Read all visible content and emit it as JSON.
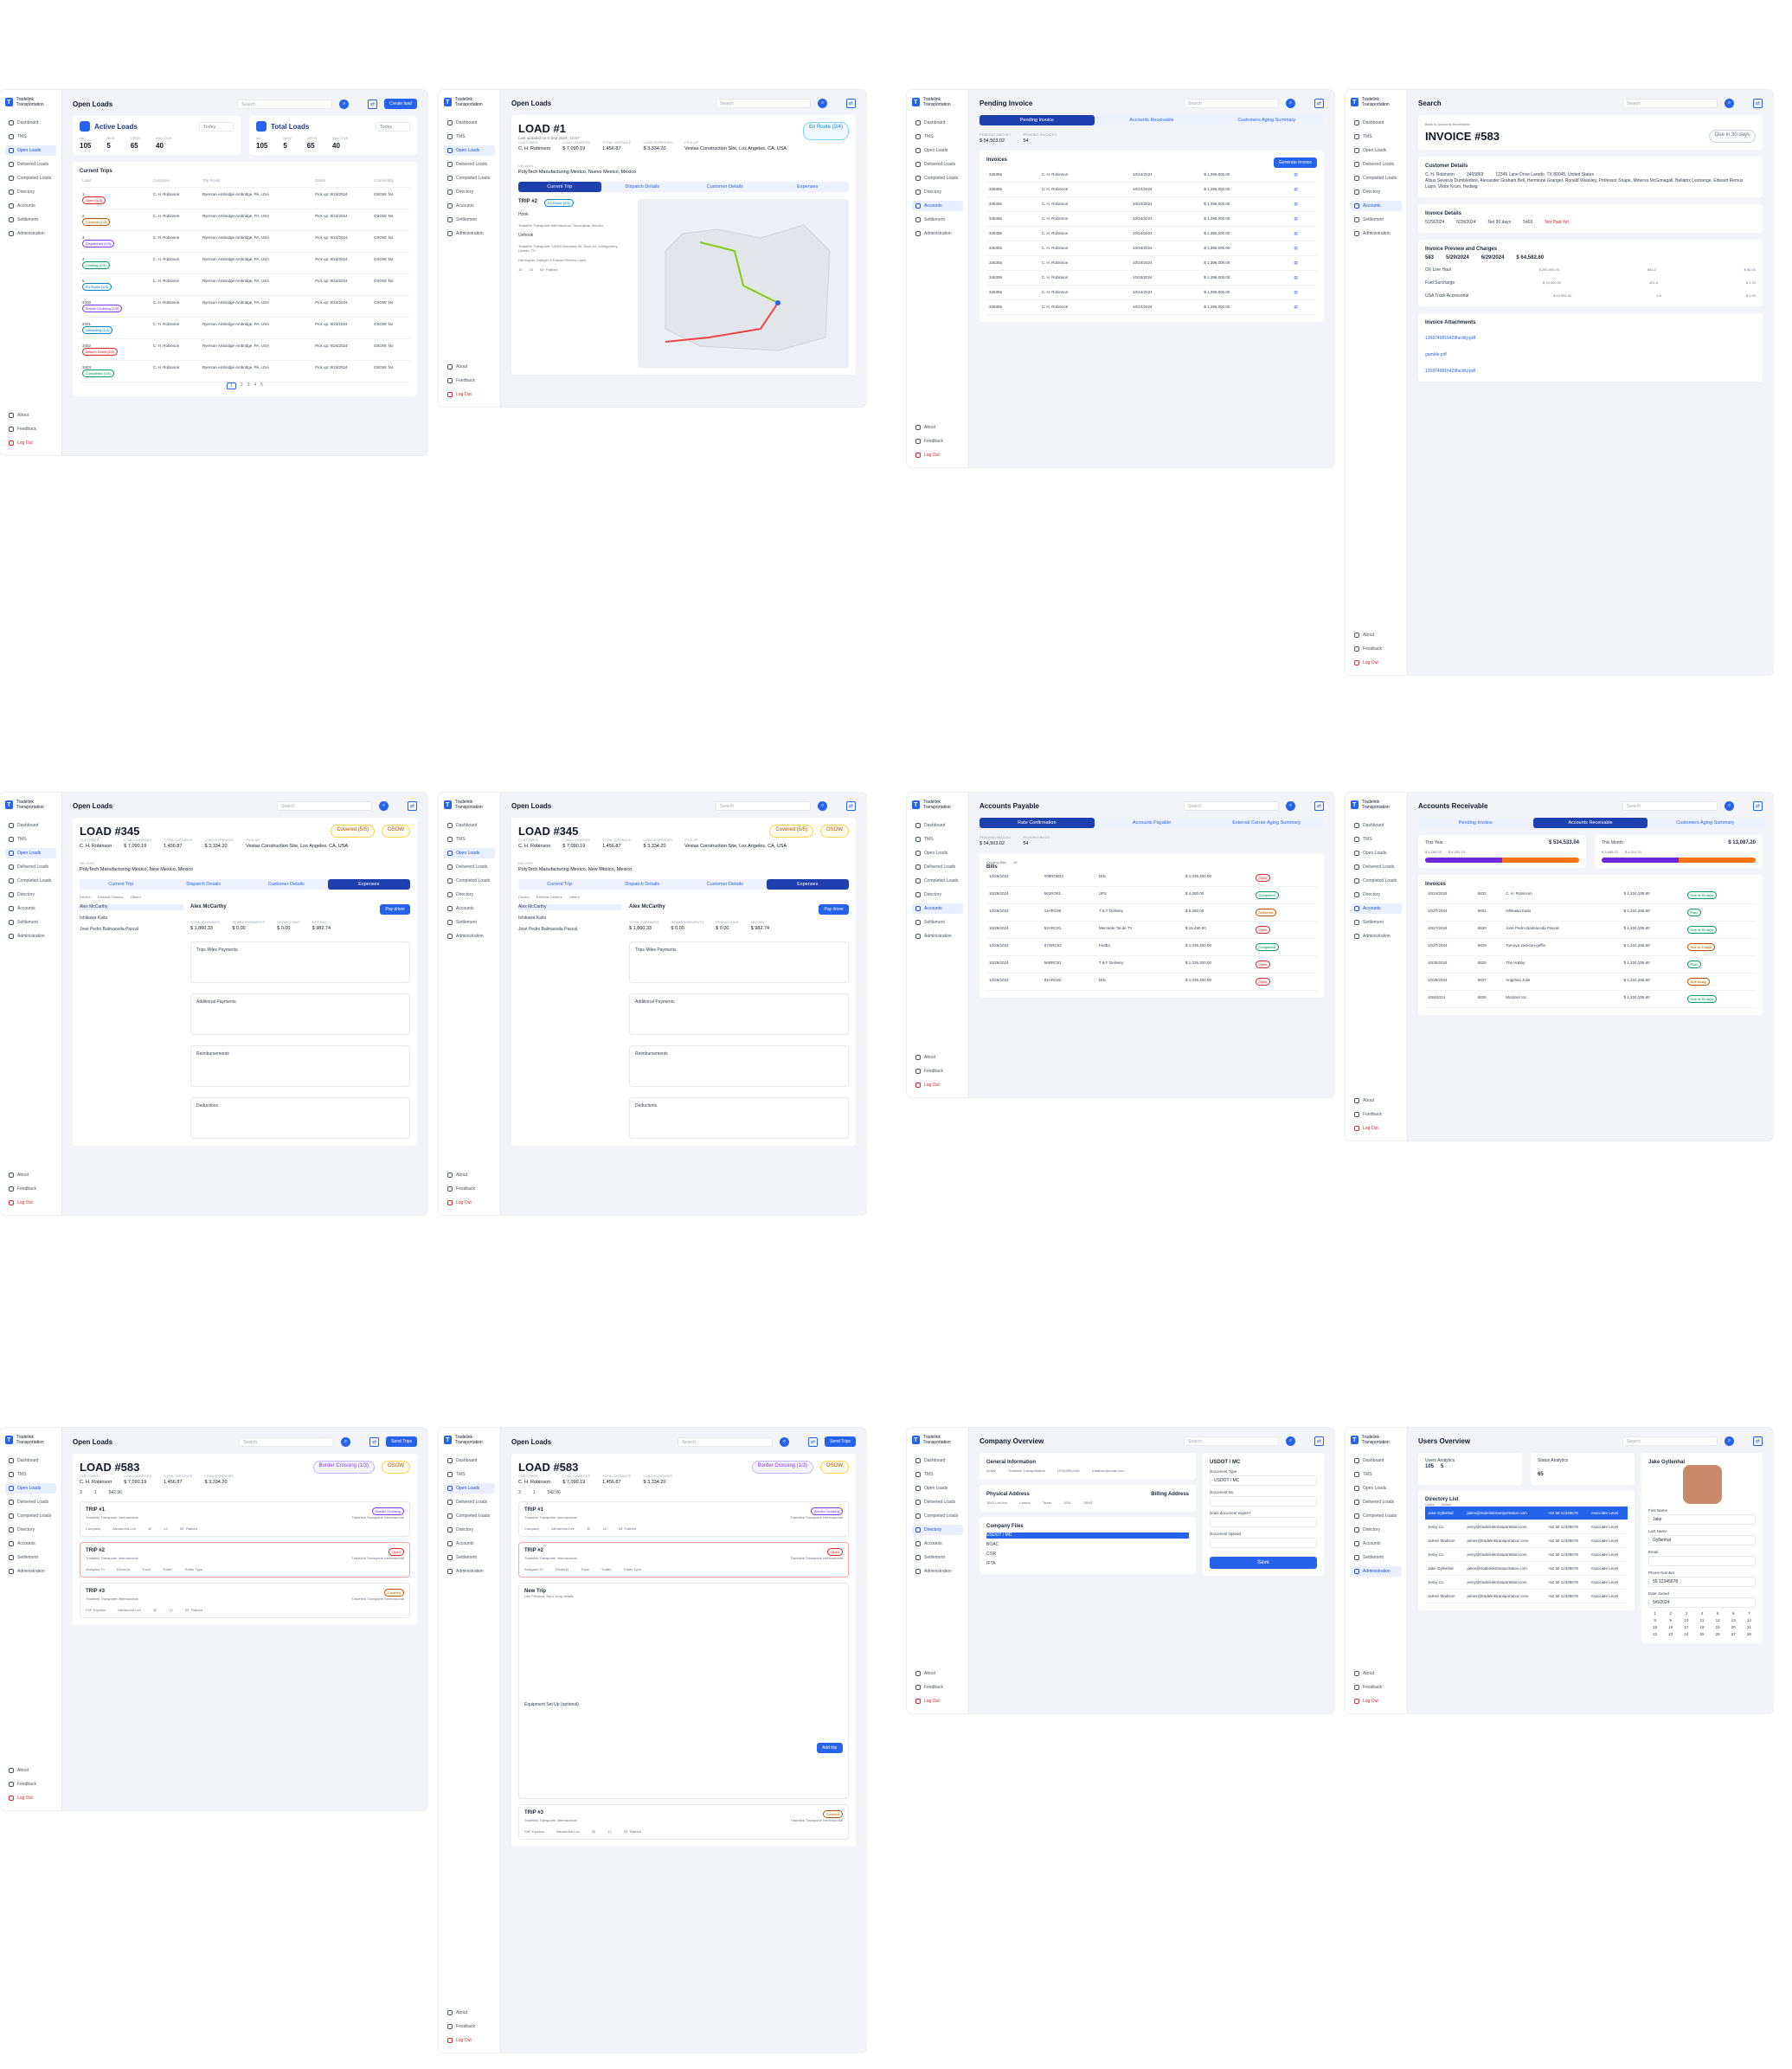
{
  "brand": {
    "name": "Tradelink Transportation"
  },
  "nav": [
    "Dashboard",
    "TMS",
    "Open Loads",
    "Delivered Loads",
    "Completed Loads",
    "Directory",
    "Accounts",
    "Settlement",
    "Administration",
    "About",
    "Feedback",
    "Log Out"
  ],
  "search_placeholder": "Search",
  "open_loads": {
    "title": "Open Loads",
    "create_btn": "Create load",
    "active": {
      "label": "Active Loads",
      "range": "Today",
      "vals": [
        {
          "k": "All",
          "v": "105"
        },
        {
          "k": "New",
          "v": "5"
        },
        {
          "k": "Open",
          "v": "65"
        },
        {
          "k": "Inactive",
          "v": "40"
        }
      ]
    },
    "total": {
      "label": "Total Loads",
      "range": "Today",
      "vals": [
        {
          "k": "All",
          "v": "105"
        },
        {
          "k": "New",
          "v": "5"
        },
        {
          "k": "Open",
          "v": "65"
        },
        {
          "k": "Inactive",
          "v": "40"
        }
      ]
    },
    "trips_title": "Current Trips",
    "columns": [
      "Load",
      "Customer",
      "Trip Route",
      "Dates",
      "Commodity"
    ],
    "rows": [
      {
        "load": "1",
        "status": "Open (1/4)",
        "color": "red",
        "customer": "C. H. Robinson",
        "route": "Ryerson Ambridge Ambridge, PA, USA",
        "dates": "Pick up: 8/24/2024",
        "commodity": "OSOW: No"
      },
      {
        "load": "2",
        "status": "Covered (1/3)",
        "color": "amber",
        "customer": "C. H. Robinson",
        "route": "Ryerson Ambridge Ambridge, PA, USA",
        "dates": "Pick up: 8/24/2024",
        "commodity": "OSOW: No"
      },
      {
        "load": "3",
        "status": "Dispatched (1/3)",
        "color": "purple",
        "customer": "C. H. Robinson",
        "route": "Ryerson Ambridge Ambridge, PA, USA",
        "dates": "Pick up: 8/24/2024",
        "commodity": "OSOW: No"
      },
      {
        "load": "4",
        "status": "Loading (1/3)",
        "color": "green",
        "customer": "C. H. Robinson",
        "route": "Ryerson Ambridge Ambridge, PA, USA",
        "dates": "Pick up: 8/24/2024",
        "commodity": "OSOW: No"
      },
      {
        "load": "5",
        "status": "En Route (1/3)",
        "color": "blue",
        "customer": "C. H. Robinson",
        "route": "Ryerson Ambridge Ambridge, PA, USA",
        "dates": "Pick up: 8/24/2024",
        "commodity": "OSOW: No"
      },
      {
        "load": "3400",
        "status": "Border Crossing (1/3)",
        "color": "purple",
        "customer": "C. H. Robinson",
        "route": "Ryerson Ambridge Ambridge, PA, USA",
        "dates": "Pick up: 8/24/2024",
        "commodity": "OSOW: No"
      },
      {
        "load": "3401",
        "status": "Unloading (1/3)",
        "color": "blue",
        "customer": "C. H. Robinson",
        "route": "Ryerson Ambridge Ambridge, PA, USA",
        "dates": "Pick up: 8/24/2024",
        "commodity": "OSOW: No"
      },
      {
        "load": "3402",
        "status": "Broken Down (1/3)",
        "color": "red",
        "customer": "C. H. Robinson",
        "route": "Ryerson Ambridge Ambridge, PA, USA",
        "dates": "Pick up: 8/24/2024",
        "commodity": "OSOW: No"
      },
      {
        "load": "3403",
        "status": "Completed (1/3)",
        "color": "green",
        "customer": "C. H. Robinson",
        "route": "Ryerson Ambridge Ambridge, PA, USA",
        "dates": "Pick up: 8/24/2024",
        "commodity": "OSOW: No"
      }
    ],
    "pages": [
      "1",
      "2",
      "3",
      "4",
      "5"
    ]
  },
  "load1": {
    "title": "LOAD #1",
    "updated": "Last updated on 8 Sep 2024, 12:47",
    "status": "En Route (2/4)",
    "meta": [
      {
        "k": "Customer",
        "v": "C. H. Robinson"
      },
      {
        "k": "Load Charges",
        "v": "$ 7,090.19"
      },
      {
        "k": "Total Distance",
        "v": "1,456.87"
      },
      {
        "k": "Load Expenses",
        "v": "$ 3,334.20"
      },
      {
        "k": "Pick Up",
        "v": "Vestas Construction Site, Los Angeles, CA, USA"
      },
      {
        "k": "Deliver",
        "v": "PolyTech Manufacturing Mexico, Nuevo Mexico, Mexico"
      }
    ],
    "tabs": [
      "Current Trip",
      "Dispatch Details",
      "Customer Details",
      "Expenses"
    ],
    "trip": "TRIP #2",
    "trip_status": "En Route (2/4)",
    "hook": "Hook",
    "unhook": "Unhook",
    "hook_addr": "Tradelink Transporte Internacional, Tamaulipas, Mexico",
    "unhook_addr": "Tradelink Transporte, 13000 Interstate 35, Suite #4, Montgomery, Laredo, TX",
    "driver": "Hermoplas Granger & Edward Remus Lupin",
    "truck": "12",
    "trailer": "23",
    "trailer_type": "53\" Flatbed"
  },
  "pending_invoice": {
    "title": "Pending Invoice",
    "tabs": [
      "Pending Invoice",
      "Accounts Receivable",
      "Customers Aging Summary"
    ],
    "amount_label": "Pending Amount",
    "amount": "$ 54,503.02",
    "count_label": "Pending Invoices",
    "count": "54",
    "section": "Invoices",
    "generate": "Generate Invoice",
    "rows": [
      {
        "id": "345355",
        "customer": "C. H. Robinson",
        "date": "10/24/2024",
        "amount": "$ 1,396,000.00"
      },
      {
        "id": "345355",
        "customer": "C. H. Robinson",
        "date": "10/24/2024",
        "amount": "$ 1,396,000.00"
      },
      {
        "id": "345355",
        "customer": "C. H. Robinson",
        "date": "10/24/2024",
        "amount": "$ 1,396,000.00"
      },
      {
        "id": "345355",
        "customer": "C. H. Robinson",
        "date": "10/24/2024",
        "amount": "$ 1,396,000.00"
      },
      {
        "id": "345355",
        "customer": "C. H. Robinson",
        "date": "10/24/2024",
        "amount": "$ 1,396,000.00"
      },
      {
        "id": "345355",
        "customer": "C. H. Robinson",
        "date": "10/24/2024",
        "amount": "$ 1,396,000.00"
      },
      {
        "id": "345355",
        "customer": "C. H. Robinson",
        "date": "10/24/2024",
        "amount": "$ 1,396,000.00"
      },
      {
        "id": "345355",
        "customer": "C. H. Robinson",
        "date": "10/24/2024",
        "amount": "$ 1,396,000.00"
      },
      {
        "id": "345355",
        "customer": "C. H. Robinson",
        "date": "10/24/2024",
        "amount": "$ 1,396,000.00"
      },
      {
        "id": "345355",
        "customer": "C. H. Robinson",
        "date": "10/24/2024",
        "amount": "$ 1,396,000.00"
      }
    ]
  },
  "invoice583": {
    "back": "Back to Accounts Receivable",
    "title": "INVOICE #583",
    "due": "Due in 30 days",
    "customer_details": "Customer Details",
    "customer": "C. H. Robinson",
    "mc": "3465869",
    "billing": "12345 Lane Drive Laredo, TX 80045, United States",
    "contacts": "Albus Severus Dumbledore, Alexander Graham Bell, Hermione Granger, Ronald Weasley, Professor Snape, Minerva McGonagall, Bellatrix Lestrange, Edward Remus Lupin, Viktor Krum, Hedwig",
    "invoice_details": "Invoice Details",
    "inv_date": "5/29/2024",
    "due_date": "6/28/2024",
    "terms": "Net 30 days",
    "load": "5403",
    "payment": "Not Paid Yet",
    "preview": "Invoice Preview and Charges",
    "invoice_no": "583",
    "invoice_date": "5/29/2024",
    "due_on": "6/29/2024",
    "total": "$ 64,582.60",
    "charges": [
      {
        "name": "OX Line Haul",
        "amt": "$ 250,000.00",
        "qty": "583.0",
        "rate": "$ 50.00"
      },
      {
        "name": "Fuel Surcharge",
        "amt": "$ 20,000.00",
        "qty": "421.4",
        "rate": "$ 2.49"
      },
      {
        "name": "USA Truck Accessorial",
        "amt": "$ 14,552.00",
        "qty": "4.5",
        "rate": "$ 1.93"
      }
    ],
    "attachments": "Invoice Attachments",
    "files": [
      "1358749816428facility.pdf",
      "gamble.pdf",
      "1358749816428facility.pdf"
    ]
  },
  "load345": {
    "title": "LOAD #345",
    "status": "Covered (5/5)",
    "osow": "OSOW",
    "meta": [
      {
        "k": "Customer",
        "v": "C. H. Robinson"
      },
      {
        "k": "Load Charges",
        "v": "$ 7,090.19"
      },
      {
        "k": "Total Distance",
        "v": "1,456.87"
      },
      {
        "k": "Load Expenses",
        "v": "$ 3,334.20"
      },
      {
        "k": "Pick Up",
        "v": "Vestas Construction Site, Los Angeles, CA, USA"
      },
      {
        "k": "Deliver",
        "v": "PolyTech Manufacturing Mexico, New Mexico, Mexico"
      }
    ],
    "tabs": [
      "Current Trip",
      "Dispatch Details",
      "Customer Details",
      "Expenses"
    ],
    "subtabs": [
      "Drivers",
      "External Carriers",
      "Others"
    ],
    "drivers": [
      "Alex McCarthy",
      "Ishikawa Kaito",
      "José Pedro Balmaceda Pascal"
    ],
    "driver_name": "Alex McCarthy",
    "pay_driver": "Pay driver",
    "sections": [
      "Trips Miles Payments",
      "Additional Payments",
      "Reimbursements",
      "Deductions"
    ],
    "totals": [
      {
        "k": "Total Earnings",
        "v": "$ 1,860.33"
      },
      {
        "k": "Reimbursements",
        "v": "$ 0.00"
      },
      {
        "k": "Deductions",
        "v": "$ 0.00"
      },
      {
        "k": "Net Pay",
        "v": "$ 982.74"
      }
    ]
  },
  "accounts_payable": {
    "title": "Accounts Payable",
    "tabs": [
      "Rate Confirmation",
      "Accounts Payable",
      "External Carrier Aging Summary"
    ],
    "pending_label": "Pending Amount",
    "pending": "$ 54,503.02",
    "bills_label": "Pending Bills",
    "bills_count": "54",
    "subtabs": [
      "Pending Bills",
      "All"
    ],
    "section": "Bills",
    "rows": [
      {
        "date": "10/29/2024",
        "conf": "#09ROB22",
        "carrier": "DHL",
        "amount": "$ 1,035,200.00",
        "status": "Open",
        "color": "red"
      },
      {
        "date": "10/29/2024",
        "conf": "562RO81",
        "carrier": "UPS",
        "amount": "$ 4,000.00",
        "status": "Completed",
        "color": "green"
      },
      {
        "date": "10/29/2024",
        "conf": "11HRC88",
        "carrier": "T & F Delivery",
        "amount": "$ 6,250.00",
        "status": "Delivered",
        "color": "amber"
      },
      {
        "date": "10/29/2024",
        "conf": "52ARC81",
        "carrier": "Mercante Tal de TV",
        "amount": "$ 15,490.00",
        "status": "Open",
        "color": "red"
      },
      {
        "date": "10/29/2024",
        "conf": "07ORC62",
        "carrier": "FedEx",
        "amount": "$ 1,035,200.00",
        "status": "Completed",
        "color": "green"
      },
      {
        "date": "10/29/2024",
        "conf": "56RRC81",
        "carrier": "T & F Delivery",
        "amount": "$ 1,035,200.00",
        "status": "Open",
        "color": "red"
      },
      {
        "date": "10/29/2024",
        "conf": "81ARC82",
        "carrier": "DHL",
        "amount": "$ 1,035,200.00",
        "status": "Open",
        "color": "red"
      }
    ]
  },
  "accounts_receivable": {
    "title": "Accounts Receivable",
    "tabs": [
      "Pending Invoice",
      "Accounts Receivable",
      "Customers Aging Summary"
    ],
    "year_label": "This Year",
    "year_total": "$ 534,533.04",
    "month_label": "This Month",
    "month_total": "$ 13,087.20",
    "overdue_label": "Overdue",
    "overdue": "$ 4,265.03",
    "current_label": "Current",
    "current": "$ 6,255.15",
    "m_overdue": "$ 5,685.03",
    "m_current": "$ 4,210.70",
    "section": "Invoices",
    "rows": [
      {
        "date": "10/24/2024",
        "id": "5832",
        "customer": "C. H. Robinson",
        "amount": "$ 1,234,285.90",
        "status": "Due in 30 days",
        "color": "green"
      },
      {
        "date": "10/27/2024",
        "id": "5831",
        "customer": "Ishikawa Kaito",
        "amount": "$ 1,234,285.90",
        "status": "Paid",
        "color": "green"
      },
      {
        "date": "10/27/2024",
        "id": "5830",
        "customer": "José Pedro Balmaceda Pascal",
        "amount": "$ 1,234,285.90",
        "status": "Due in 30 days",
        "color": "green"
      },
      {
        "date": "10/27/2024",
        "id": "5829",
        "customer": "Tomoya Jackson-griffin",
        "amount": "$ 1,234,285.90",
        "status": "Due in 5 days",
        "color": "amber"
      },
      {
        "date": "10/30/2024",
        "id": "5828",
        "customer": "The Hobby",
        "amount": "$ 1,234,285.90",
        "status": "Paid",
        "color": "green"
      },
      {
        "date": "10/30/2024",
        "id": "5827",
        "customer": "Angelina Jolie",
        "amount": "$ 1,234,285.90",
        "status": "Due today",
        "color": "amber"
      },
      {
        "date": "10/6/2024",
        "id": "5826",
        "customer": "Mordoor Inc.",
        "amount": "$ 1,234,285.90",
        "status": "Due in 30 days",
        "color": "green"
      }
    ]
  },
  "load583": {
    "title": "LOAD #583",
    "status": "Border Crossing (1/3)",
    "osow": "OSOW",
    "send_trips": "Send Trips",
    "meta": [
      {
        "k": "Customer",
        "v": "C. H. Robinson"
      },
      {
        "k": "Load Charges",
        "v": "$ 7,090.19"
      },
      {
        "k": "Total Distance",
        "v": "1,456.87"
      },
      {
        "k": "Load Expenses",
        "v": "$ 3,334.20"
      }
    ],
    "total_trips": "3",
    "open_trips": "1",
    "miles": "542.96",
    "trips": [
      {
        "name": "TRIP #1",
        "status": "Border Crossing",
        "color": "purple",
        "from": "Tradelink Transporte Internacional",
        "to": "Tradelink Transporte Internacional",
        "assigned": "Company",
        "driver": "Alexandria Lee",
        "truck": "32",
        "trailer": "12",
        "trailer_type": "53\" Flatbed"
      },
      {
        "name": "TRIP #2",
        "status": "Open",
        "color": "red",
        "from": "Tradelink Transporte Internacional",
        "to": "Tradelink Transporte Internacional",
        "assigned": "Assigned To",
        "driver": "Driver(s)",
        "truck": "Truck",
        "trailer": "Trailer",
        "trailer_type": "Trailer Type"
      },
      {
        "name": "TRIP #3",
        "status": "Covered",
        "color": "amber",
        "from": "Tradelink Transporte Internacional",
        "to": "Tradelink Transporte Internacional",
        "assigned": "F&F Express",
        "driver": "Alexandria Lee",
        "truck": "32",
        "trailer": "12",
        "trailer_type": "53\" Flatbed"
      }
    ],
    "new_trip": "New Trip",
    "use_prev": "Use Previous Trip's Drop details",
    "equipment": "Equipment Set Up (optional)",
    "add_trip": "Add trip"
  },
  "company": {
    "title": "Company Overview",
    "general": "General Information",
    "status": "Active",
    "company_name": "Tradelink Transportation",
    "contact": "(325)555-6481",
    "email": "tradelink@email.com",
    "physical": "Physical Address",
    "billing": "Billing Address",
    "address": "1500 Lott Ave",
    "city": "Laredo",
    "country": "USA",
    "state": "Texas",
    "zip": "78045",
    "files": "Company Files",
    "file_rows": [
      "USDOT / MC",
      "BOAC",
      "COR",
      "IFTA"
    ],
    "modal_title": "USDOT / MC",
    "doc_type_label": "Document Type",
    "doc_type": "USDOT / MC",
    "doc_no_label": "Document No",
    "approve_label": "Does document expire?",
    "upload_label": "Document Upload",
    "save": "Save"
  },
  "users": {
    "title": "Users Overview",
    "users_label": "Users Analytics",
    "total": "105",
    "new": "5",
    "status_label": "Status Analytics",
    "active": "65",
    "directory": "Directory List",
    "tabs": [
      "Users",
      "Invites"
    ],
    "rows": [
      {
        "name": "Jake Gyllenhal",
        "email": "jakes@tradelinktransportation.com",
        "phone": "+52 55 12345678",
        "role": "Associate Level"
      },
      {
        "name": "Jessy Co",
        "email": "jessy@tradelinktransportation.com",
        "phone": "+52 55 12345678",
        "role": "Associate Level"
      },
      {
        "name": "James Madison",
        "email": "james@tradelinktransportation.com",
        "phone": "+52 55 12345678",
        "role": "Associate Level"
      },
      {
        "name": "Jessy Co",
        "email": "jessy@tradelinktransportation.com",
        "phone": "+52 55 12345678",
        "role": "Associate Level"
      },
      {
        "name": "Jake Gyllenhal",
        "email": "jakes@tradelinktransportation.com",
        "phone": "+52 55 12345678",
        "role": "Associate Level"
      },
      {
        "name": "Jessy Co",
        "email": "jessy@tradelinktransportation.com",
        "phone": "+52 55 12345678",
        "role": "Associate Level"
      },
      {
        "name": "James Madison",
        "email": "james@tradelinktransportation.com",
        "phone": "+52 55 12345678",
        "role": "Associate Level"
      }
    ],
    "profile_name": "Jake Gyllenhal",
    "first_label": "First Name",
    "first": "Jake",
    "last_label": "Last Name",
    "last": "Gyllenhal",
    "email_label": "Email",
    "phone_label": "Phone Number",
    "phone": "55 12345678",
    "date_label": "Date Joined",
    "date": "5/6/2024"
  }
}
